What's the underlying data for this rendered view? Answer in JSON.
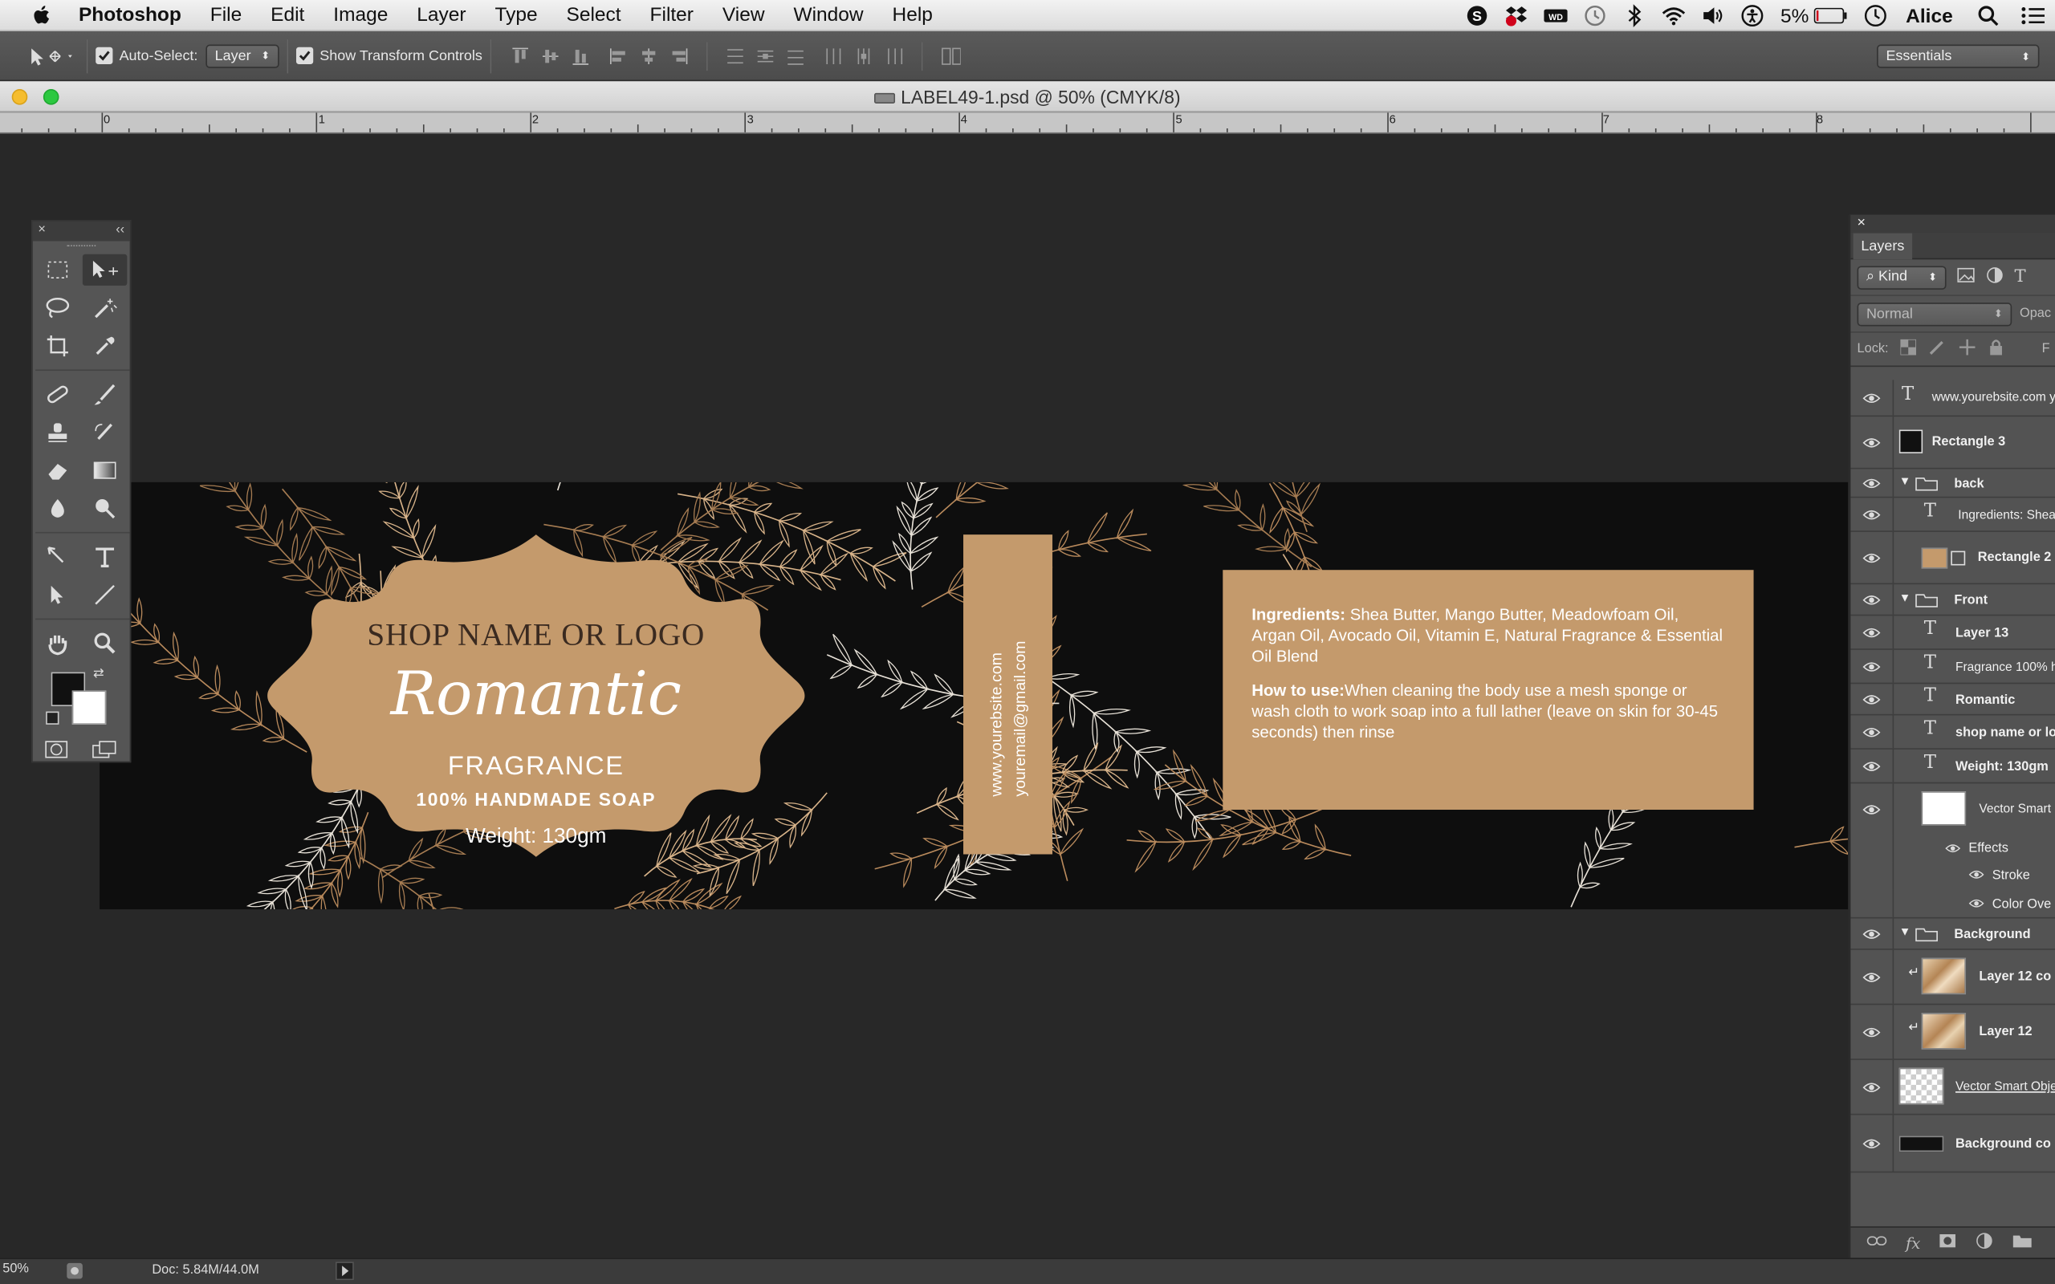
{
  "menubar": {
    "app_name": "Photoshop",
    "items": [
      "File",
      "Edit",
      "Image",
      "Layer",
      "Type",
      "Select",
      "Filter",
      "View",
      "Window",
      "Help"
    ],
    "battery": "5%",
    "user": "Alice"
  },
  "options": {
    "auto_select_label": "Auto-Select:",
    "auto_select_value": "Layer",
    "show_transform_label": "Show Transform Controls",
    "workspace": "Essentials"
  },
  "document": {
    "title": "LABEL49-1.psd @ 50% (CMYK/8)"
  },
  "ruler": {
    "labels": [
      "0",
      "1",
      "2",
      "3",
      "4",
      "5",
      "6",
      "7",
      "8"
    ]
  },
  "label": {
    "shop_name": "SHOP NAME OR LOGO",
    "product_name": "Romantic",
    "fragrance": "FRAGRANCE",
    "handmade": "100% HANDMADE SOAP",
    "weight": "Weight: 130gm",
    "website": "www.yourebsite.com",
    "email": "youremail@gmail.com",
    "ingredients_title": "Ingredients:",
    "ingredients_text": " Shea Butter, Mango Butter, Meadowfoam Oil, Argan Oil, Avocado Oil, Vitamin E, Natural Fragrance & Essential Oil Blend",
    "howto_title": "How to use:",
    "howto_text": "When cleaning the body use a mesh sponge or wash cloth to work soap into a full lather (leave on skin for 30-45 seconds) then rinse"
  },
  "layers_panel": {
    "tab": "Layers",
    "filter_kind": "Kind",
    "blend_mode": "Normal",
    "opacity_label": "Opac",
    "lock_label": "Lock:",
    "fill_label": "F",
    "layers": [
      {
        "name": "www.yourebsite.com y",
        "type": "text"
      },
      {
        "name": "Rectangle 3",
        "type": "shape"
      },
      {
        "name": "back",
        "type": "group"
      },
      {
        "name": "Ingredients: Shea",
        "type": "text"
      },
      {
        "name": "Rectangle 2",
        "type": "shape"
      },
      {
        "name": "Front",
        "type": "group"
      },
      {
        "name": "Layer 13",
        "type": "text"
      },
      {
        "name": "Fragrance 100% h",
        "type": "text"
      },
      {
        "name": "Romantic",
        "type": "text"
      },
      {
        "name": "shop name or lo",
        "type": "text"
      },
      {
        "name": "Weight: 130gm",
        "type": "text"
      },
      {
        "name": "Vector Smart C",
        "type": "smart"
      },
      {
        "name": "Effects",
        "type": "effects"
      },
      {
        "name": "Stroke",
        "type": "effect"
      },
      {
        "name": "Color Ove",
        "type": "effect"
      },
      {
        "name": "Background",
        "type": "group"
      },
      {
        "name": "Layer 12 co",
        "type": "image"
      },
      {
        "name": "Layer 12",
        "type": "image"
      },
      {
        "name": "Vector Smart Obje",
        "type": "smart"
      },
      {
        "name": "Background co",
        "type": "fill"
      }
    ]
  },
  "statusbar": {
    "zoom": "50%",
    "doc_info": "Doc: 5.84M/44.0M"
  },
  "colors": {
    "label_tan": "#c49a6c",
    "label_bg": "#0e0e0e",
    "leaf_gold": "#b98a5c",
    "panel_bg": "#535353",
    "workspace_bg": "#282828"
  }
}
